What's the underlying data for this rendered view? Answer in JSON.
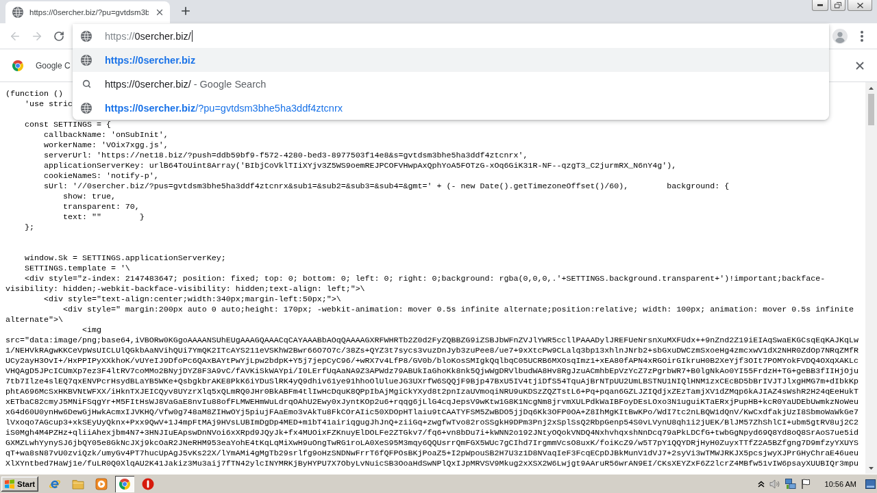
{
  "tabs": [
    {
      "title": "https://0sercher.biz/?pu=gvtdsm3b",
      "selected": true
    }
  ],
  "toolbar": {
    "back": {
      "disabled": true
    },
    "forward": {
      "disabled": true
    }
  },
  "omnibox": {
    "focused": true,
    "value": [
      {
        "text": "https://",
        "dim": true
      },
      {
        "text": "0sercher.biz/",
        "dim": false
      }
    ],
    "suggestions": [
      {
        "kind": "url",
        "selected": true,
        "text": "https://0sercher.biz"
      },
      {
        "kind": "search",
        "selected": false,
        "text": "https://0sercher.biz/",
        "detail": "- Google Search"
      },
      {
        "kind": "url",
        "selected": false,
        "text": "https://0sercher.biz",
        "detail": "/?pu=gvtdsm3bhe5ha3ddf4ztcnrx"
      }
    ]
  },
  "infobar": {
    "text": "Google C"
  },
  "code": {
    "sections": [
      {
        "kind": "head",
        "lines": [
          "(function ()",
          "    'use stric"
        ]
      },
      {
        "kind": "settings",
        "lines": [
          "    const SETTINGS = {",
          "        callbackName: 'onSubInit',",
          "        workerName: 'VOix7xgg.js',",
          "        serverUrl: 'https://net18.biz/?push=ddb59bf9-f572-4280-bed3-8977503f14e8&s=gvtdsm3bhe5ha3ddf4ztcnrx',",
          "        applicationServerKey: urlB64ToUint8Array('BIbjCoVklTIiXYjv3Z5WS9oemREJPCOFVHwpAxQphYoA5FOTzG-xOq6GiK31R-NF--qzgT3_C2jurmRX_N6nY4g'),",
          "        cookieNameS: 'notify-p',",
          "        sUrl: '//0sercher.biz/?pus=gvtdsm3bhe5ha3ddf4ztcnrx&sub1=&sub2=&sub3=&sub4=&gmt=' + (- new Date().getTimezoneOffset()/60),        background: {",
          "            show: true,",
          "            transparent: 70,",
          "            text: \"\"        }",
          "    };"
        ]
      },
      {
        "kind": "template",
        "lines": [
          "    window.Sk = SETTINGS.applicationServerKey;",
          "    SETTINGS.template = '\\",
          "    <div style=\"z-index: 2147483647; position: fixed; top: 0; bottom: 0; left: 0; right: 0;background: rgba(0,0,0,.'+SETTINGS.background.transparent+')!important;backface-",
          "visibility: hidden;-webkit-backface-visibility: hidden;text-align: left;\">\\",
          "        <div style=\"text-align:center;width:340px;margin-left:50px;\">\\",
          "            <div style=\" margin:200px auto 0 auto;height: 170px; -webkit-animation: mover 0.5s infinite alternate;position:relative; width: 100px; animation: mover 0.5s infinite",
          "alternate\">\\",
          "                <img",
          "src=\"data:image/png;base64,iVBORw0KGgoAAAANSUhEUgAAAGQAAACqCAYAAABbAOqQAAAAGXRFWHRTb2Z0d2FyZQBBZG9iZSBJbWFnZVJlYWR5ccllPAAADylJREFUeNrsnXuMXFUdx++9nZnd2Z19iEIAqSwaEKGCsqEqKAJKqLw",
          "1/NEHVkRAgwKKCeVpWsUICLUlQGkbAaNVihQUi7YmQK2ITcAYS211eVSKhW2Bwr66O7O7c/38Zs+QYZ3t7sycs3vuzDnJyb3zuPee8/ue7+9xXtcPw9CLalq3bp13xhlnJNrb2+sbGxuDWCzmSxoeHg4zmcxwV1dX2NHR0ZdOp7NRqZMfR",
          "UCy2ayH3OvI+/HxPPIPyXXkhoK/vUYeIJ9DfoPc6QAxBAYtPwYjLpw2bdpK+Y5j7jepCyC96/+wRX7v4LfP8/GV0b/bloKosSMIgkQqlbqC05UCRB6MXOsqImz1+xEA80fAPN4xRGOirGIkruH0B2XeYjf3OIt7POMYokFVDQ4OXqXAKLc",
          "VHQAgD5JPcICUmXp7ez3F4ltRV7coMMo2BNyjDYZ8F3A9vC/fAVKiSkWAYpi/I0LErfUqAaNA9Z3APWdz79ABUkIaGhoKk8nk5QjwWgDRVlbudWA8Hv8RgJzuACmhbEpVzYcZ7zPgrbWR7+B0lgNkAo0YI55FrdzH+TG+geBB3fIIHjOju",
          "7tb7Ilze4slEQ7qxENVPcrHsydBLaYB5WKe+QsbgkbrAKE8PkK6iYDuSlRK4yQ9dhiv61ye91hhoOlUlueJG3UXrfW6SQQjF9Bjp47BxU5IV4tjiDfS54TquAjBrNTpUU2UmLBSTNU1NIQlHNM1zxCEcBD5bBrIVJTJlxgHMG7m+dIbkKp",
          "phtA696McSxHKBVNtWFXX/iHknTXJEICQyv8UYzrXlq5xQLmRQ0JHr0BkABFm4tlIwHcDquK8QPpIbAjMgiCkYXyd8t2pnIzaUVmoqiNRU9uKDSzZQZTstL6+Pq+pqan6GZLJZIQdjxZEzTamjXV1dZMqp6kAJIAZ4sWshR2H24qEeHukT",
          "xETbaC82cmyJ5MNiFSqgYr+M5FItHsWJ8VaGaE8nvIu88ofFLMWEHmWuLdrqOAhU2Ewy0xJyntKOp2u6+rqqg6jLlG4cqJepsV9wKtw1G8K1NcgNm8jrvmXULPdkWaIBFoyDEsLOxo3N1uguiKTaERxjPupHB+kcR0YaUDEbUwmkzNoWeu",
          "xG4d60U0ynHw6DewGjHwkAcmxIJVKHQ/Vfw0g748aM8ZIHwOYj5piujFAaEmo3vAkTu8FkCOrAIic50XDOpHTlaiu9tCAATYFSM5ZwBDO5jjDq6Kk3OFP0OA+Z8IhMgKItBwKPo/WdI7tc2nLBQW1dQnV/KwCxdfakjUzI8SbmoWaWkGe7",
          "lVxoqo7AGcup3+xkSEyUyQknx+Pxx9QwV+1J4mpFtMAj9HVsLUBImDgDp4MED+m1bT41airiqgugJhJnQ+ziiGq+zwgfwTvo82roSSgkH9DPm3Pnj2xSplSsQ2RbpGenp54S0vLVynU8qh1i2jUEK/BlJM57ZhShlCI+ubm5gtRV8uj2C2",
          "iS0Mgh4M4PZHz+qliiAhexjbm4N7+3HNJIuEApswDnNVoi6xXRpd9JQyJk+fx4MUOixFZKnuyElDOLFe2ZTGkv7/fq6+vn8bDu7i+kWNN2o192JNtyOQokVNDQ4NxhvhqxshNnDcq79aPkLDCfG+twbGgNpyd69Q8Yd8oQ8SrAoS7ue5id",
          "GXMZLwhYynySJ6jbQY05e8GkNcJXj9kcOaR2JNeRHM953eaYohE4tKqLqMiXwH9uOngTwRG1roLA0XeS95M3mqy6QQUsrrQmFGX5WUc7gCIhd7IrgmmVcsO8uxK/foiKcZ9/w5T7pY1QQYDRjHyH0ZuyxTTfZ2A5BZfgng7D9mfzyYXUYS",
          "qT+wa8sN87vU0zviQzk/umyGv4PT7hucUpAgJ5vKs22X/lYmAMi4gMgTb29srlfg9oHzSNDNwFrrT6fQFPOsBKjPoaZ5+I2pWpouSB2H7U3z1D8NVaqIeF3FcqECpDJBkMunV1dVJ7+2syVi3wTMWJRKJX5pcsjwyXJPrGHyChraE46ueu",
          "XlXYntbed7HaWj1e/fuLR0Q0XlqAU2K41Jakiz3Mu3aij7fTN42ylcINYMRKjByHYPU7X7ObyLvNuicSB3OoaHdSwNPlQxIJpMRVSV9Mkug2xXSX2W6Lwjgt9AAruR56wrAN9EI/CKsXEYZxF6Z2lcrZ4MBfw51vIW6psayXUUBIQr3mpu"
        ]
      }
    ]
  },
  "taskbar": {
    "start": "Start",
    "apps": [
      {
        "kind": "ie",
        "selected": false
      },
      {
        "kind": "folder",
        "selected": false
      },
      {
        "kind": "media",
        "selected": false
      },
      {
        "kind": "chrome",
        "selected": true
      },
      {
        "kind": "alert",
        "selected": false
      }
    ],
    "clock": "10:56 AM"
  }
}
